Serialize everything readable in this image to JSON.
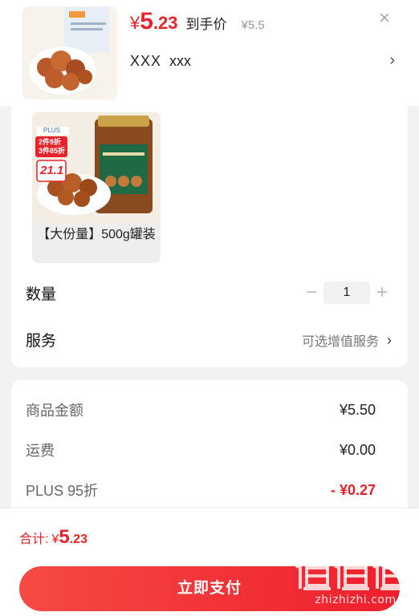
{
  "header": {
    "currency": "¥",
    "price_int": "5",
    "price_dec": ".23",
    "price_note": "到手价",
    "original_price": "¥5.5",
    "close_label": "×",
    "variant_primary": "XXX",
    "variant_secondary": "xxx",
    "variant_chevron": "›"
  },
  "sku": {
    "label": "【大份量】500g罐装",
    "image_badge_top": "PLUS",
    "image_badge_promo1": "2件9折",
    "image_badge_promo2": "3件85折",
    "image_price": "21.1"
  },
  "quantity": {
    "label": "数量",
    "minus": "−",
    "value": "1",
    "plus": "+"
  },
  "service": {
    "label": "服务",
    "value": "可选增值服务",
    "chevron": "›"
  },
  "amounts": [
    {
      "label": "商品金额",
      "value": "¥5.50",
      "emphasis": false
    },
    {
      "label": "运费",
      "value": "¥0.00",
      "emphasis": false
    },
    {
      "label": "PLUS 95折",
      "value": "- ¥0.27",
      "emphasis": true
    }
  ],
  "footer": {
    "total_label": "合计:",
    "currency": "¥",
    "total_int": "5",
    "total_dec": ".23",
    "pay_label": "立即支付"
  },
  "watermark": {
    "logo_text": "值值值",
    "url": "zhizhizhi.com"
  },
  "colors": {
    "accent": "#e8232c",
    "background": "#f2f2f2"
  }
}
